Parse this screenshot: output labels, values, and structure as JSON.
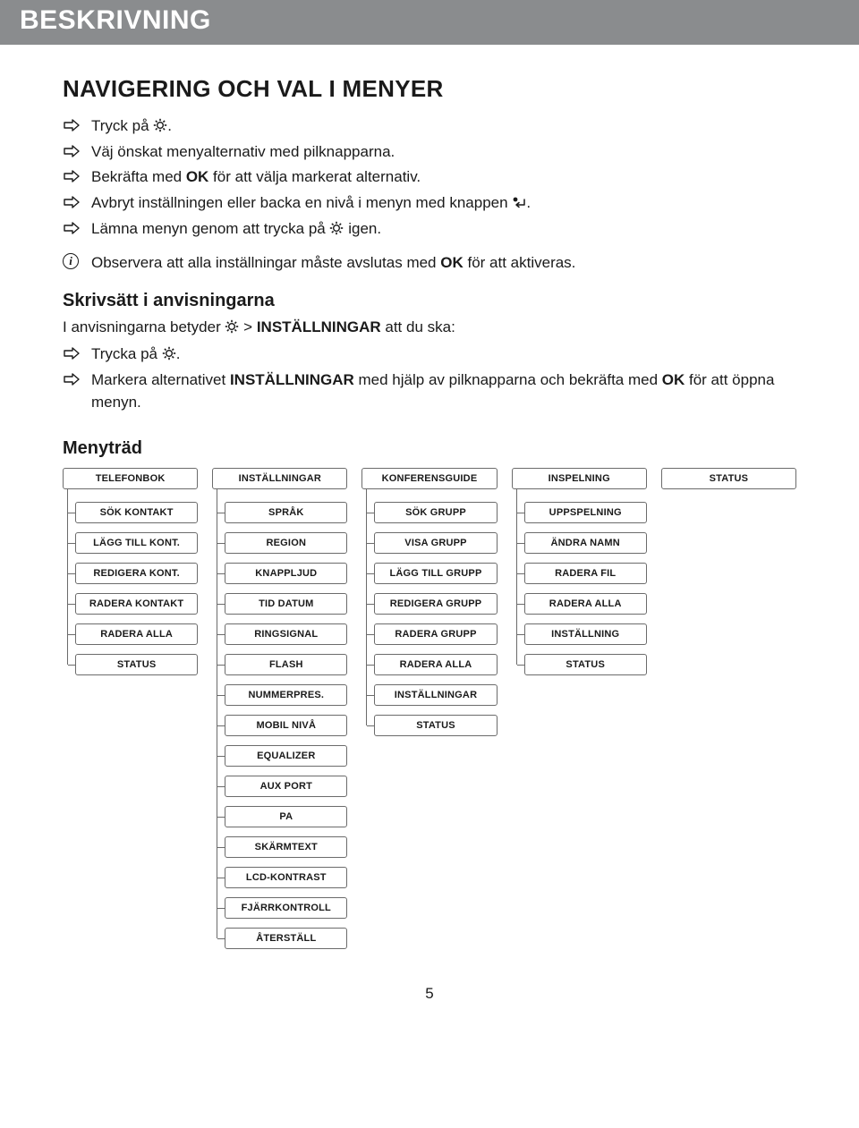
{
  "header": "BESKRIVNING",
  "section_title": "NAVIGERING OCH VAL I MENYER",
  "nav_steps": {
    "s1a": "Tryck på ",
    "s1b": ".",
    "s2": "Väj önskat menyalternativ med pilknapparna.",
    "s3a": "Bekräfta med ",
    "s3b": "OK",
    "s3c": " för att välja markerat alternativ.",
    "s4a": "Avbryt inställningen eller backa en nivå i menyn med knappen ",
    "s4b": ".",
    "s5a": "Lämna menyn genom att trycka på ",
    "s5b": " igen."
  },
  "info": {
    "a": "Observera att alla inställningar måste avslutas med ",
    "b": "OK",
    "c": " för att aktiveras."
  },
  "skriv_title": "Skrivsätt i anvisningarna",
  "skriv_intro": {
    "a": "I anvisningarna betyder ",
    "b": " > ",
    "c": "INSTÄLLNINGAR",
    "d": " att du ska:"
  },
  "skriv_steps": {
    "s1a": "Trycka på ",
    "s1b": ".",
    "s2a": "Markera alternativet ",
    "s2b": "INSTÄLLNINGAR",
    "s2c": " med hjälp av pilknapparna och bekräfta med ",
    "s2d": "OK",
    "s2e": " för att öppna menyn."
  },
  "menytrad_title": "Menyträd",
  "tree": [
    {
      "head": "TELEFONBOK",
      "items": [
        "SÖK KONTAKT",
        "LÄGG TILL KONT.",
        "REDIGERA KONT.",
        "RADERA KONTAKT",
        "RADERA ALLA",
        "STATUS"
      ]
    },
    {
      "head": "INSTÄLLNINGAR",
      "items": [
        "SPRÅK",
        "REGION",
        "KNAPPLJUD",
        "TID DATUM",
        "RINGSIGNAL",
        "FLASH",
        "NUMMERPRES.",
        "MOBIL NIVÅ",
        "EQUALIZER",
        "AUX PORT",
        "PA",
        "SKÄRMTEXT",
        "LCD-KONTRAST",
        "FJÄRRKONTROLL",
        "ÅTERSTÄLL"
      ]
    },
    {
      "head": "KONFERENSGUIDE",
      "items": [
        "SÖK GRUPP",
        "VISA GRUPP",
        "LÄGG TILL GRUPP",
        "REDIGERA GRUPP",
        "RADERA GRUPP",
        "RADERA ALLA",
        "INSTÄLLNINGAR",
        "STATUS"
      ]
    },
    {
      "head": "INSPELNING",
      "items": [
        "UPPSPELNING",
        "ÄNDRA NAMN",
        "RADERA FIL",
        "RADERA ALLA",
        "INSTÄLLNING",
        "STATUS"
      ]
    },
    {
      "head": "STATUS",
      "items": []
    }
  ],
  "page_number": "5"
}
